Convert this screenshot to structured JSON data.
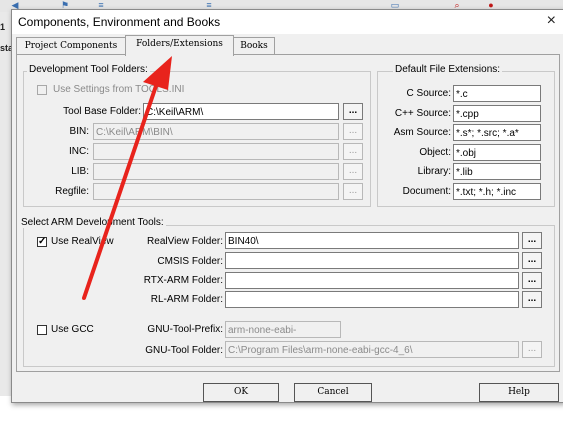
{
  "dialog": {
    "title": "Components, Environment and Books"
  },
  "tabs": [
    {
      "label": "Project Components"
    },
    {
      "label": "Folders/Extensions"
    },
    {
      "label": "Books"
    }
  ],
  "background": {
    "left_strip_top": "1",
    "left_strip_tab": "sta"
  },
  "dev_tool_folders": {
    "group_label": "Development Tool Folders:",
    "use_settings_label": "Use Settings from TOOLS.INI",
    "tool_base_label": "Tool Base Folder:",
    "tool_base_value": "C:\\Keil\\ARM\\",
    "bin_label": "BIN:",
    "bin_value": "C:\\Keil\\ARM\\BIN\\",
    "inc_label": "INC:",
    "lib_label": "LIB:",
    "regfile_label": "Regfile:"
  },
  "extensions": {
    "group_label": "Default File Extensions:",
    "items": [
      {
        "label": "C Source:",
        "value": "*.c"
      },
      {
        "label": "C++ Source:",
        "value": "*.cpp"
      },
      {
        "label": "Asm Source:",
        "value": "*.s*; *.src; *.a*"
      },
      {
        "label": "Object:",
        "value": "*.obj"
      },
      {
        "label": "Library:",
        "value": "*.lib"
      },
      {
        "label": "Document:",
        "value": "*.txt; *.h; *.inc"
      }
    ]
  },
  "arm_tools": {
    "group_label": "Select ARM Development Tools:",
    "use_realview_label": "Use RealView",
    "realview_label": "RealView Folder:",
    "realview_value": "BIN40\\",
    "cmsis_label": "CMSIS Folder:",
    "rtx_label": "RTX-ARM Folder:",
    "rl_label": "RL-ARM Folder:",
    "use_gcc_label": "Use GCC",
    "gnu_prefix_label": "GNU-Tool-Prefix:",
    "gnu_prefix_value": "arm-none-eabi-",
    "gnu_folder_label": "GNU-Tool Folder:",
    "gnu_folder_value": "C:\\Program Files\\arm-none-eabi-gcc-4_6\\"
  },
  "browse_label": "...",
  "checkmark": "✓",
  "buttons": {
    "ok": "OK",
    "cancel": "Cancel",
    "help": "Help"
  },
  "icons": {
    "close": "×"
  },
  "annotation": {
    "arrow_color": "#e8231c"
  }
}
